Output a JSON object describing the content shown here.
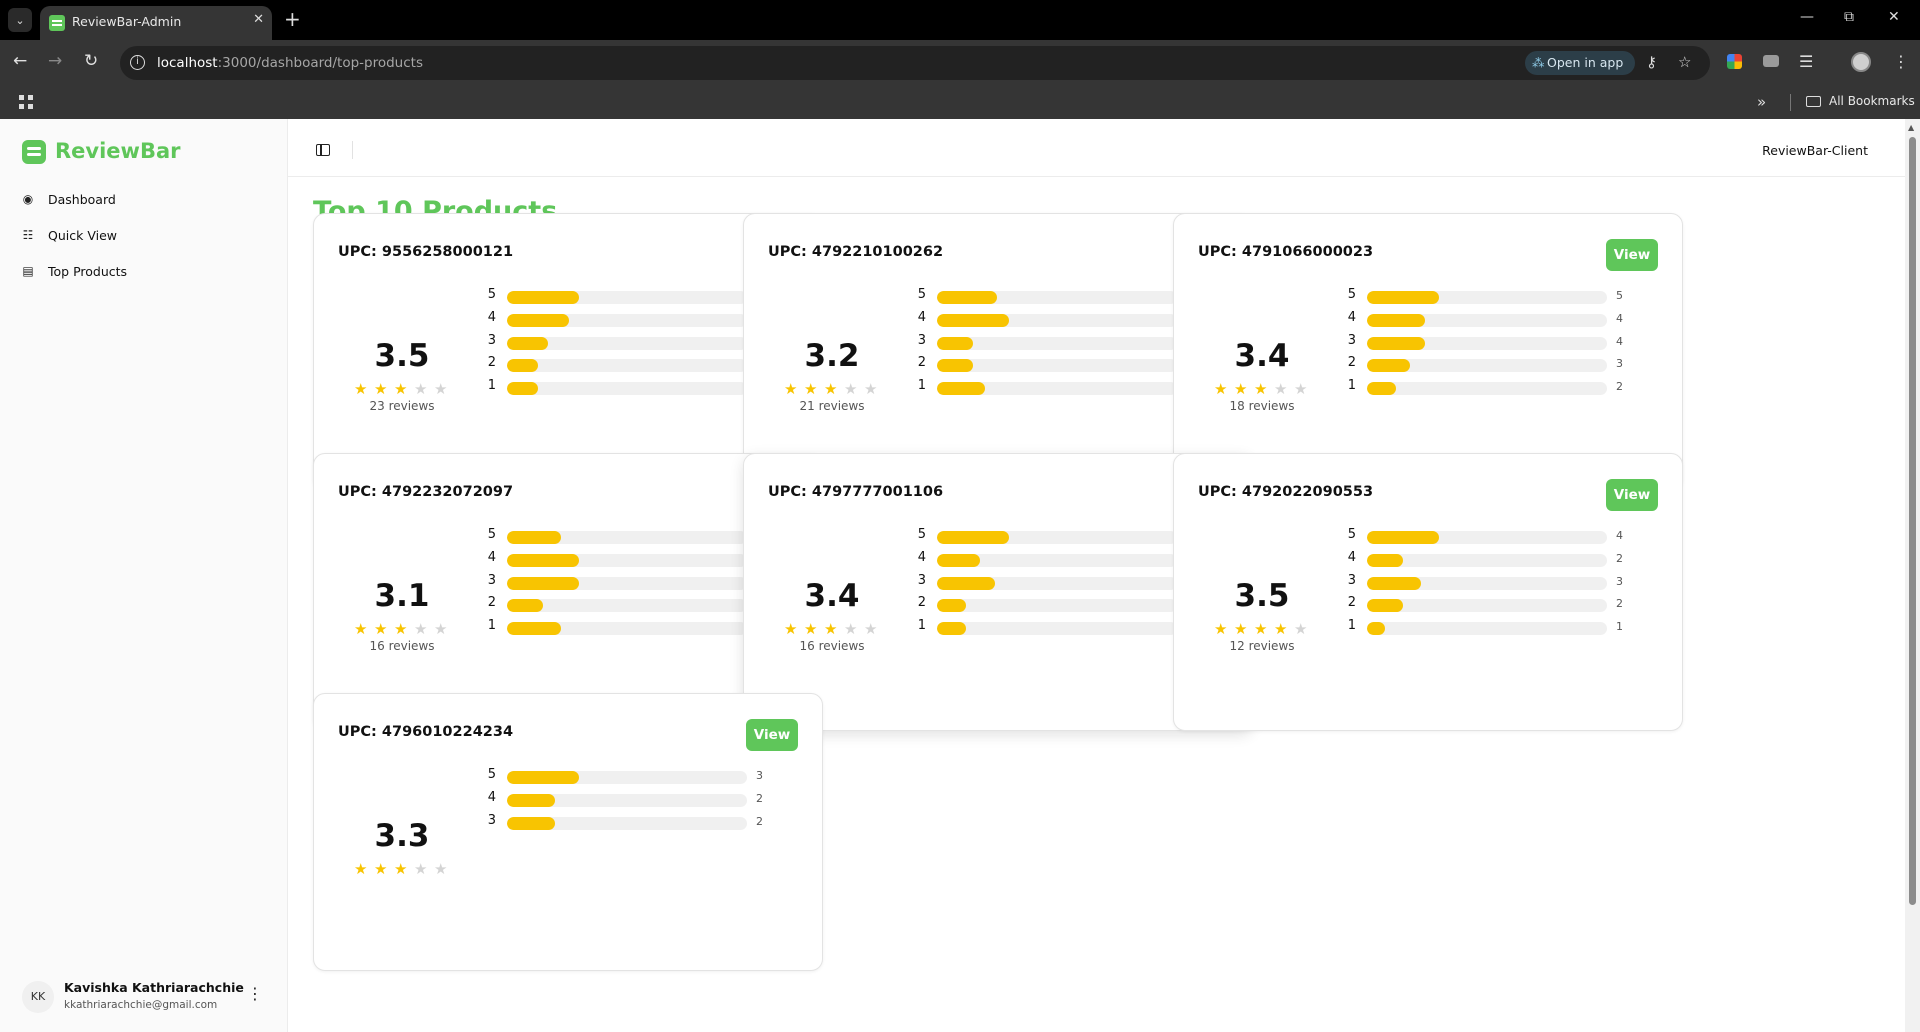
{
  "browser": {
    "tab_title": "ReviewBar-Admin",
    "url_host": "localhost",
    "url_rest": ":3000/dashboard/top-products",
    "open_in_app": "Open in app",
    "bookmarks_label": "All Bookmarks"
  },
  "sidebar": {
    "brand": "ReviewBar",
    "items": [
      {
        "label": "Dashboard",
        "icon": "dashboard-icon"
      },
      {
        "label": "Quick View",
        "icon": "list-icon"
      },
      {
        "label": "Top Products",
        "icon": "bar-chart-icon"
      }
    ],
    "user": {
      "initials": "KK",
      "name": "Kavishka Kathriarachchie",
      "email": "kkathriarachchie@gmail.com"
    }
  },
  "topbar": {
    "client_label": "ReviewBar-Client"
  },
  "page": {
    "title": "Top 10 Products",
    "view_label": "View",
    "accent_color": "#5fc65a",
    "bar_color": "#f8c401"
  },
  "products": [
    {
      "upc": "UPC: 9556258000121",
      "rating": "3.5",
      "stars_filled": 3,
      "reviews": "23 reviews",
      "distribution": [
        {
          "star": "5",
          "count": "7"
        },
        {
          "star": "4",
          "count": "6"
        },
        {
          "star": "3",
          "count": "4"
        },
        {
          "star": "2",
          "count": "3"
        },
        {
          "star": "1",
          "count": "3"
        }
      ]
    },
    {
      "upc": "UPC: 4792210100262",
      "rating": "3.2",
      "stars_filled": 3,
      "reviews": "21 reviews",
      "distribution": [
        {
          "star": "5",
          "count": "5"
        },
        {
          "star": "4",
          "count": "6"
        },
        {
          "star": "3",
          "count": "3"
        },
        {
          "star": "2",
          "count": "3"
        },
        {
          "star": "1",
          "count": "4"
        }
      ]
    },
    {
      "upc": "UPC: 4791066000023",
      "rating": "3.4",
      "stars_filled": 3,
      "reviews": "18 reviews",
      "distribution": [
        {
          "star": "5",
          "count": "5"
        },
        {
          "star": "4",
          "count": "4"
        },
        {
          "star": "3",
          "count": "4"
        },
        {
          "star": "2",
          "count": "3"
        },
        {
          "star": "1",
          "count": "2"
        }
      ]
    },
    {
      "upc": "UPC: 4792232072097",
      "rating": "3.1",
      "stars_filled": 3,
      "reviews": "16 reviews",
      "distribution": [
        {
          "star": "5",
          "count": "3"
        },
        {
          "star": "4",
          "count": "4"
        },
        {
          "star": "3",
          "count": "4"
        },
        {
          "star": "2",
          "count": "2"
        },
        {
          "star": "1",
          "count": "3"
        }
      ]
    },
    {
      "upc": "UPC: 4797777001106",
      "rating": "3.4",
      "stars_filled": 3,
      "reviews": "16 reviews",
      "distribution": [
        {
          "star": "5",
          "count": "5"
        },
        {
          "star": "4",
          "count": "3"
        },
        {
          "star": "3",
          "count": "4"
        },
        {
          "star": "2",
          "count": "2"
        },
        {
          "star": "1",
          "count": "2"
        }
      ]
    },
    {
      "upc": "UPC: 4792022090553",
      "rating": "3.5",
      "stars_filled": 4,
      "reviews": "12 reviews",
      "distribution": [
        {
          "star": "5",
          "count": "4"
        },
        {
          "star": "4",
          "count": "2"
        },
        {
          "star": "3",
          "count": "3"
        },
        {
          "star": "2",
          "count": "2"
        },
        {
          "star": "1",
          "count": "1"
        }
      ]
    },
    {
      "upc": "UPC: 4796010224234",
      "rating": "3.3",
      "stars_filled": 3,
      "reviews": "",
      "distribution": [
        {
          "star": "5",
          "count": "3"
        },
        {
          "star": "4",
          "count": "2"
        },
        {
          "star": "3",
          "count": "2"
        }
      ]
    }
  ]
}
